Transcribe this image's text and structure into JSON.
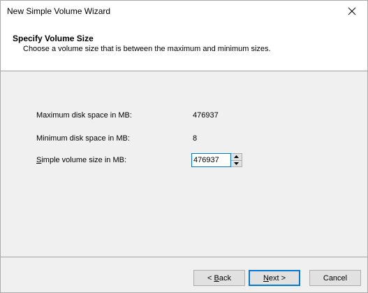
{
  "window": {
    "title": "New Simple Volume Wizard",
    "close_icon": "close-icon"
  },
  "header": {
    "title": "Specify Volume Size",
    "subtitle": "Choose a volume size that is between the maximum and minimum sizes."
  },
  "fields": {
    "max_label": "Maximum disk space in MB:",
    "max_value": "476937",
    "min_label": "Minimum disk space in MB:",
    "min_value": "8",
    "size_label_prefix": "S",
    "size_label_rest": "imple volume size in MB:",
    "size_value": "476937"
  },
  "buttons": {
    "back_prefix": "< ",
    "back_ul": "B",
    "back_rest": "ack",
    "next_ul": "N",
    "next_rest": "ext >",
    "cancel": "Cancel"
  },
  "colors": {
    "accent": "#0078d7",
    "button_face": "#e1e1e1",
    "dialog_bg": "#f0f0f0"
  }
}
